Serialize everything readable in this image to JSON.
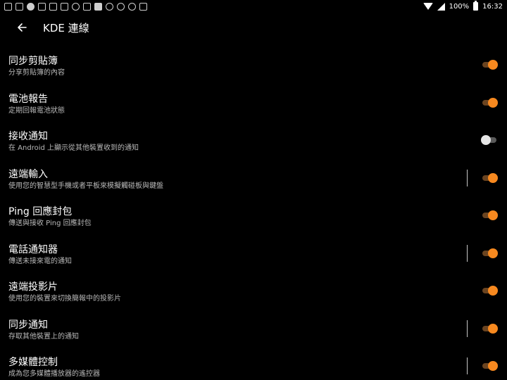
{
  "status_bar": {
    "battery_text": "100%",
    "time": "16:32",
    "notification_icons": [
      "sms-icon",
      "mail-icon",
      "spotify-icon",
      "instagram-icon",
      "instagram-icon",
      "instagram-icon",
      "speedometer-icon",
      "cloud-icon",
      "image-icon",
      "podcast-icon",
      "whatsapp-icon",
      "location-icon",
      "instagram-icon"
    ]
  },
  "app_bar": {
    "title": "KDE 連線"
  },
  "settings": [
    {
      "title": "同步剪貼簿",
      "subtitle": "分享剪貼簿的內容",
      "enabled": true,
      "has_divider": false
    },
    {
      "title": "電池報告",
      "subtitle": "定期回報電池狀態",
      "enabled": true,
      "has_divider": false
    },
    {
      "title": "接收通知",
      "subtitle": "在 Android 上顯示從其他裝置收到的通知",
      "enabled": false,
      "has_divider": false
    },
    {
      "title": "遠端輸入",
      "subtitle": "使用您的智慧型手機或者平板來模擬觸碰板與鍵盤",
      "enabled": true,
      "has_divider": true
    },
    {
      "title": "Ping 回應封包",
      "subtitle": "傳送與接收 Ping 回應封包",
      "enabled": true,
      "has_divider": false
    },
    {
      "title": "電話通知器",
      "subtitle": "傳送未接來電的通知",
      "enabled": true,
      "has_divider": true
    },
    {
      "title": "遠端投影片",
      "subtitle": "使用您的裝置來切換簡報中的投影片",
      "enabled": true,
      "has_divider": false
    },
    {
      "title": "同步通知",
      "subtitle": "存取其他裝置上的通知",
      "enabled": true,
      "has_divider": true
    },
    {
      "title": "多媒體控制",
      "subtitle": "成為您多媒體播放器的遙控器",
      "enabled": true,
      "has_divider": true
    }
  ],
  "colors": {
    "background": "#000000",
    "accent": "#f7891f",
    "accent_track": "#6b4420"
  }
}
